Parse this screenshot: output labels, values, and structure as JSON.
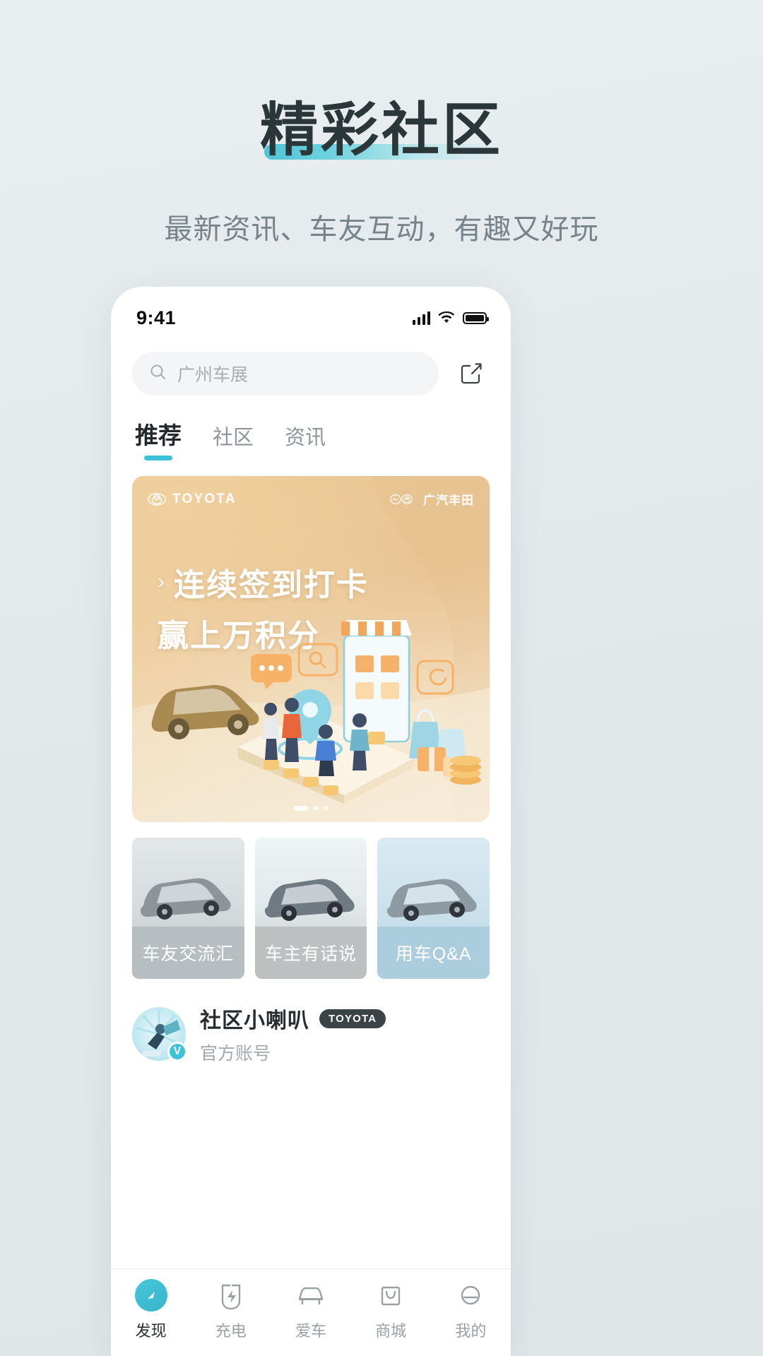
{
  "promo": {
    "title": "精彩社区",
    "subtitle": "最新资讯、车友互动，有趣又好玩",
    "accent_color": "#3cc3d8"
  },
  "status_bar": {
    "time": "9:41",
    "signal_icon": "signal-bars-icon",
    "wifi_icon": "wifi-icon",
    "battery_icon": "battery-full-icon"
  },
  "search": {
    "placeholder": "广州车展",
    "search_icon": "search-icon",
    "compose_icon": "compose-edit-icon"
  },
  "tabs": [
    {
      "label": "推荐",
      "active": true
    },
    {
      "label": "社区",
      "active": false
    },
    {
      "label": "资讯",
      "active": false
    }
  ],
  "banner": {
    "brand": "TOYOTA",
    "brand_icon": "toyota-logo-icon",
    "cobrand": "广汽丰田",
    "cobrand_icon": "gac-toyota-logo-icon",
    "chevron": "›",
    "headline_line1": "连续签到打卡",
    "headline_line2": "赢上万积分",
    "dots_total": 3,
    "dots_active_index": 0,
    "bg_color": "#e7c28f"
  },
  "cards": [
    {
      "label": "车友交流汇",
      "strip_color": "#b6bec2"
    },
    {
      "label": "车主有话说",
      "strip_color": "#bcc0c1"
    },
    {
      "label": "用车Q&A",
      "strip_color": "#accddd"
    }
  ],
  "account": {
    "name": "社区小喇叭",
    "tag": "TOYOTA",
    "subtitle": "官方账号",
    "verified_badge": "V",
    "avatar_icon": "megaphone-avatar-icon"
  },
  "tabbar": [
    {
      "label": "发现",
      "icon": "compass-discover-icon",
      "active": true
    },
    {
      "label": "充电",
      "icon": "charging-bolt-icon",
      "active": false
    },
    {
      "label": "爱车",
      "icon": "car-icon",
      "active": false
    },
    {
      "label": "商城",
      "icon": "shopping-bag-icon",
      "active": false
    },
    {
      "label": "我的",
      "icon": "profile-icon",
      "active": false
    }
  ]
}
